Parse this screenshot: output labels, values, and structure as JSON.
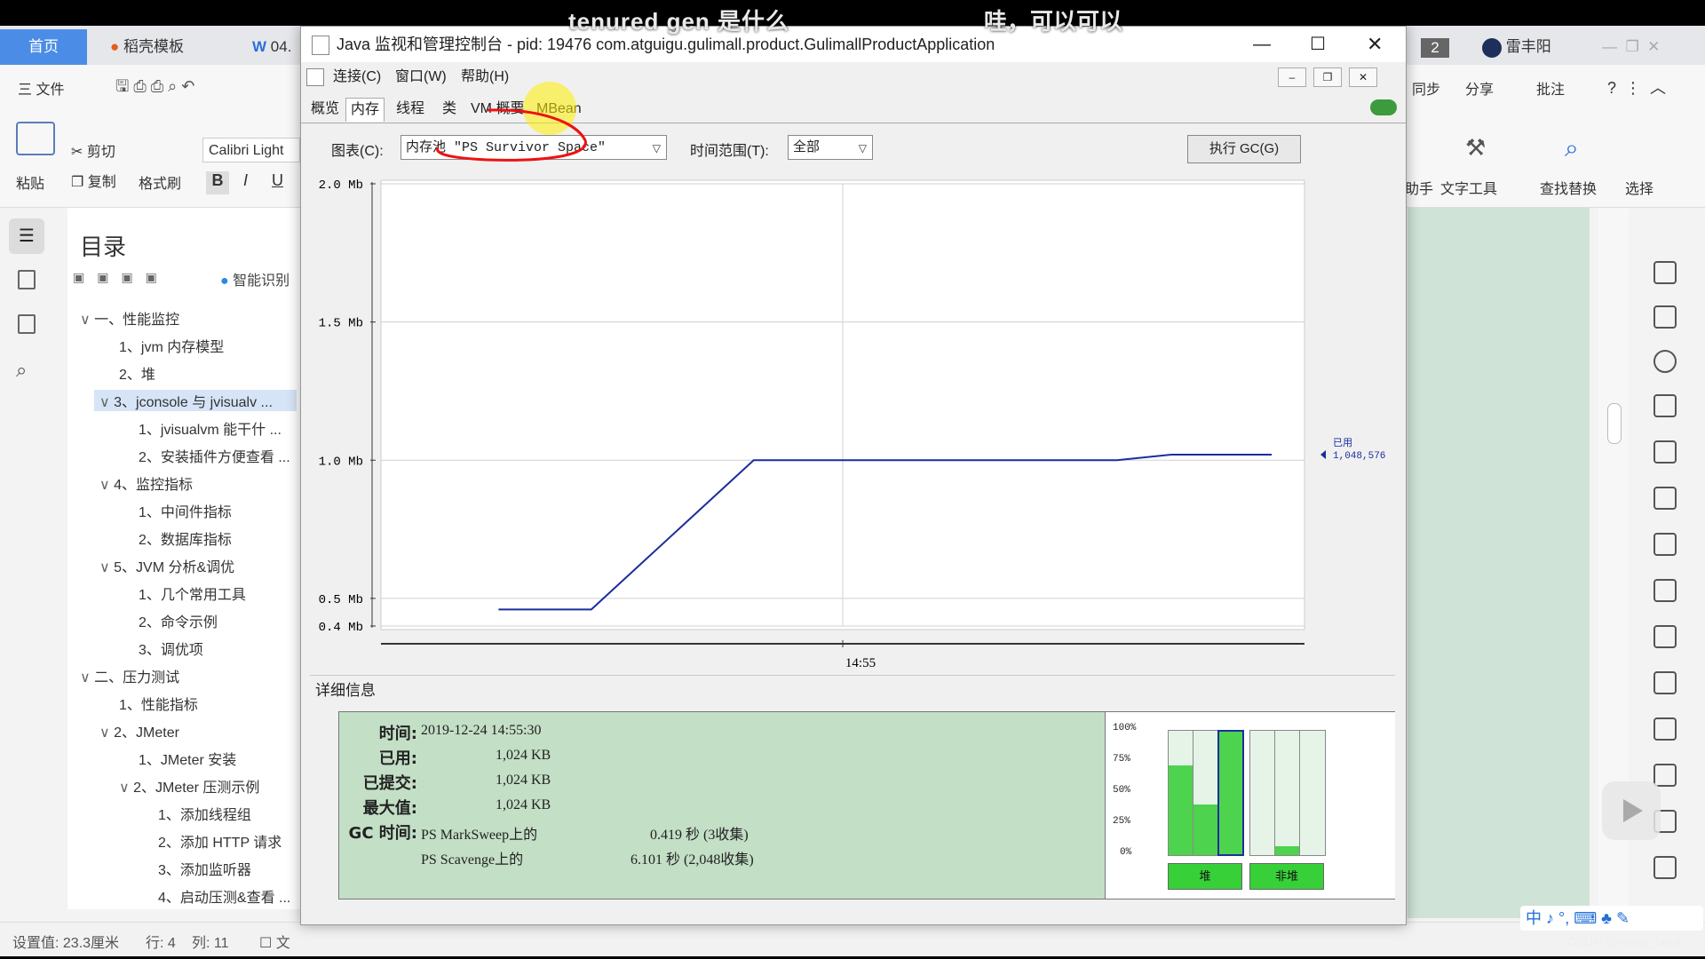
{
  "video_subtitle": [
    "tenured gen 是什么",
    "哇，可以可以"
  ],
  "wps": {
    "tabs": [
      {
        "label": "首页"
      },
      {
        "label": "稻壳模板"
      },
      {
        "label": "04."
      },
      {
        "label": "2"
      },
      {
        "label": "雷丰阳"
      }
    ],
    "toolbar": {
      "file_label": "三 文件",
      "sync_label": "同步",
      "share_label": "分享",
      "annotate_label": "批注"
    },
    "ribbon": {
      "paste": "粘贴",
      "cut": "剪切",
      "copy": "复制",
      "format_painter": "格式刷",
      "font_name": "Calibri Light",
      "bold": "B",
      "italic": "I",
      "underline": "U",
      "assistant": "助手",
      "text_tools": "文字工具",
      "find_replace": "查找替换",
      "select": "选择"
    },
    "toc": {
      "title": "目录",
      "smart_label": "智能识别",
      "items": [
        {
          "text": "一、性能监控",
          "level": 0,
          "expanded": true
        },
        {
          "text": "1、jvm 内存模型",
          "level": 1
        },
        {
          "text": "2、堆",
          "level": 1
        },
        {
          "text": "3、jconsole 与 jvisualv ...",
          "level": 1,
          "expanded": true,
          "selected": true
        },
        {
          "text": "1、jvisualvm 能干什 ...",
          "level": 2
        },
        {
          "text": "2、安装插件方便查看 ...",
          "level": 2
        },
        {
          "text": "4、监控指标",
          "level": 1,
          "expanded": true
        },
        {
          "text": "1、中间件指标",
          "level": 2
        },
        {
          "text": "2、数据库指标",
          "level": 2
        },
        {
          "text": "5、JVM 分析&调优",
          "level": 1,
          "expanded": true
        },
        {
          "text": "1、几个常用工具",
          "level": 2
        },
        {
          "text": "2、命令示例",
          "level": 2
        },
        {
          "text": "3、调优项",
          "level": 2
        },
        {
          "text": "二、压力测试",
          "level": 0,
          "expanded": true
        },
        {
          "text": "1、性能指标",
          "level": 1
        },
        {
          "text": "2、JMeter",
          "level": 1,
          "expanded": true
        },
        {
          "text": "1、JMeter 安装",
          "level": 2
        },
        {
          "text": "2、JMeter 压测示例",
          "level": 2,
          "expanded": true
        },
        {
          "text": "1、添加线程组",
          "level": 3
        },
        {
          "text": "2、添加 HTTP 请求",
          "level": 3
        },
        {
          "text": "3、添加监听器",
          "level": 3
        },
        {
          "text": "4、启动压测&查看 ...",
          "level": 3
        }
      ]
    },
    "statusbar": {
      "setting": "设置值: 23.3厘米",
      "row": "行: 4",
      "col": "列: 11",
      "doc": "文"
    }
  },
  "jconsole": {
    "title": "Java 监视和管理控制台 - pid: 19476 com.atguigu.gulimall.product.GulimallProductApplication",
    "menus": [
      "连接(C)",
      "窗口(W)",
      "帮助(H)"
    ],
    "tabs": [
      {
        "label": "概览"
      },
      {
        "label": "内存",
        "selected": true
      },
      {
        "label": "线程"
      },
      {
        "label": "类"
      },
      {
        "label": "VM 概要"
      },
      {
        "label": "MBean"
      }
    ],
    "controls": {
      "chart_label": "图表(C):",
      "chart_value": "内存池 \"PS Survivor Space\"",
      "range_label": "时间范围(T):",
      "range_value": "全部",
      "gc_button": "执行 GC(G)"
    },
    "details": {
      "title": "详细信息",
      "rows": [
        {
          "label": "时间:",
          "value": "2019-12-24 14:55:30"
        },
        {
          "label": "已用:",
          "value": "1,024 KB"
        },
        {
          "label": "已提交:",
          "value": "1,024 KB"
        },
        {
          "label": "最大值:",
          "value": "1,024 KB"
        }
      ],
      "gc_label": "GC 时间:",
      "gc": [
        {
          "collector": "PS MarkSweep上的",
          "time": "0.419 秒 (3收集)"
        },
        {
          "collector": "PS Scavenge上的",
          "time": "6.101 秒 (2,048收集)"
        }
      ]
    },
    "memory_bars": {
      "pct_labels": [
        "100%",
        "75%",
        "50%",
        "25%",
        "0%"
      ],
      "heap_label": "堆",
      "nonheap_label": "非堆",
      "heap_fractions": [
        0.72,
        0.41,
        1.0
      ],
      "nonheap_fractions": [
        0.0,
        0.07,
        0.0
      ],
      "selected_index": 2
    }
  },
  "chart_data": {
    "type": "line",
    "title": "",
    "y_ticks": [
      "2.0 Mb",
      "1.5 Mb",
      "1.0 Mb",
      "0.5 Mb",
      "0.4 Mb"
    ],
    "x_ticks": [
      "14:55"
    ],
    "ylim": [
      0.4,
      2.0
    ],
    "y_unit": "Mb",
    "series": [
      {
        "name": "已用",
        "color": "#1a2d9c",
        "x": [
          0,
          0.12,
          0.33,
          0.8,
          0.87,
          1.0
        ],
        "values": [
          0.46,
          0.46,
          1.0,
          1.0,
          1.02,
          1.02
        ]
      }
    ],
    "end_label": "已用",
    "end_value": "1,048,576",
    "grid": true
  },
  "watermark": "CSDN @wang_book",
  "ime": "中 ♪ °, ⌨ ♣ ✎"
}
